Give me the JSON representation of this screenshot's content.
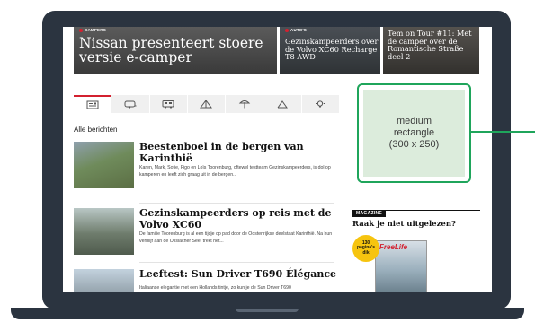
{
  "hero": [
    {
      "tag": "CAMPERS",
      "title": "Nissan presenteert stoere versie e-camper"
    },
    {
      "tag": "AUTO'S",
      "title": "Gezinskampeerders over de Volvo XC60 Recharge T8 AWD"
    },
    {
      "tag": "",
      "title": "Tem on Tour #11: Met de camper over de Romantische Straße deel 2"
    }
  ],
  "tabs": [
    {
      "icon": "newspaper-icon",
      "active": true
    },
    {
      "icon": "caravan-icon",
      "active": false
    },
    {
      "icon": "camper-icon",
      "active": false
    },
    {
      "icon": "tent-icon",
      "active": false
    },
    {
      "icon": "umbrella-icon",
      "active": false
    },
    {
      "icon": "map-icon",
      "active": false
    },
    {
      "icon": "idea-icon",
      "active": false
    }
  ],
  "all_label": "Alle berichten",
  "articles": [
    {
      "title": "Beestenboel in de bergen van Karinthië",
      "text": "Karen, Mark, Sofie, Figo en Loïs Toorenburg, oftewel testteam Gezinskampeerders, is dol op kamperen en leeft zich graag uit in de bergen..."
    },
    {
      "title": "Gezinskampeerders op reis met de Volvo XC60",
      "text": "De familie Toorenburg is al een tijdje op pad door de Oostenrijkse deelstaat Karinthië. Na hun verblijf aan de Ossiacher See, trekt het..."
    },
    {
      "title": "Leeftest: Sun Driver T690 Élégance",
      "text": "Italiaanse elegantie met een Hollands tintje, zo kun je de Sun Driver T690"
    }
  ],
  "ad": {
    "line1": "medium",
    "line2": "rectangle",
    "line3": "(300 x 250)"
  },
  "magazine": {
    "tag": "MAGAZINE",
    "title": "Raak je niet uitgelezen?",
    "badge_line1": "130",
    "badge_line2": "pagina's",
    "badge_line3": "dik",
    "cover_logo": "FreeLife"
  },
  "colors": {
    "accent": "#d3202f",
    "ad_green": "#1fa55b",
    "ad_fill": "#dcecdc",
    "frame": "#2b3440"
  }
}
